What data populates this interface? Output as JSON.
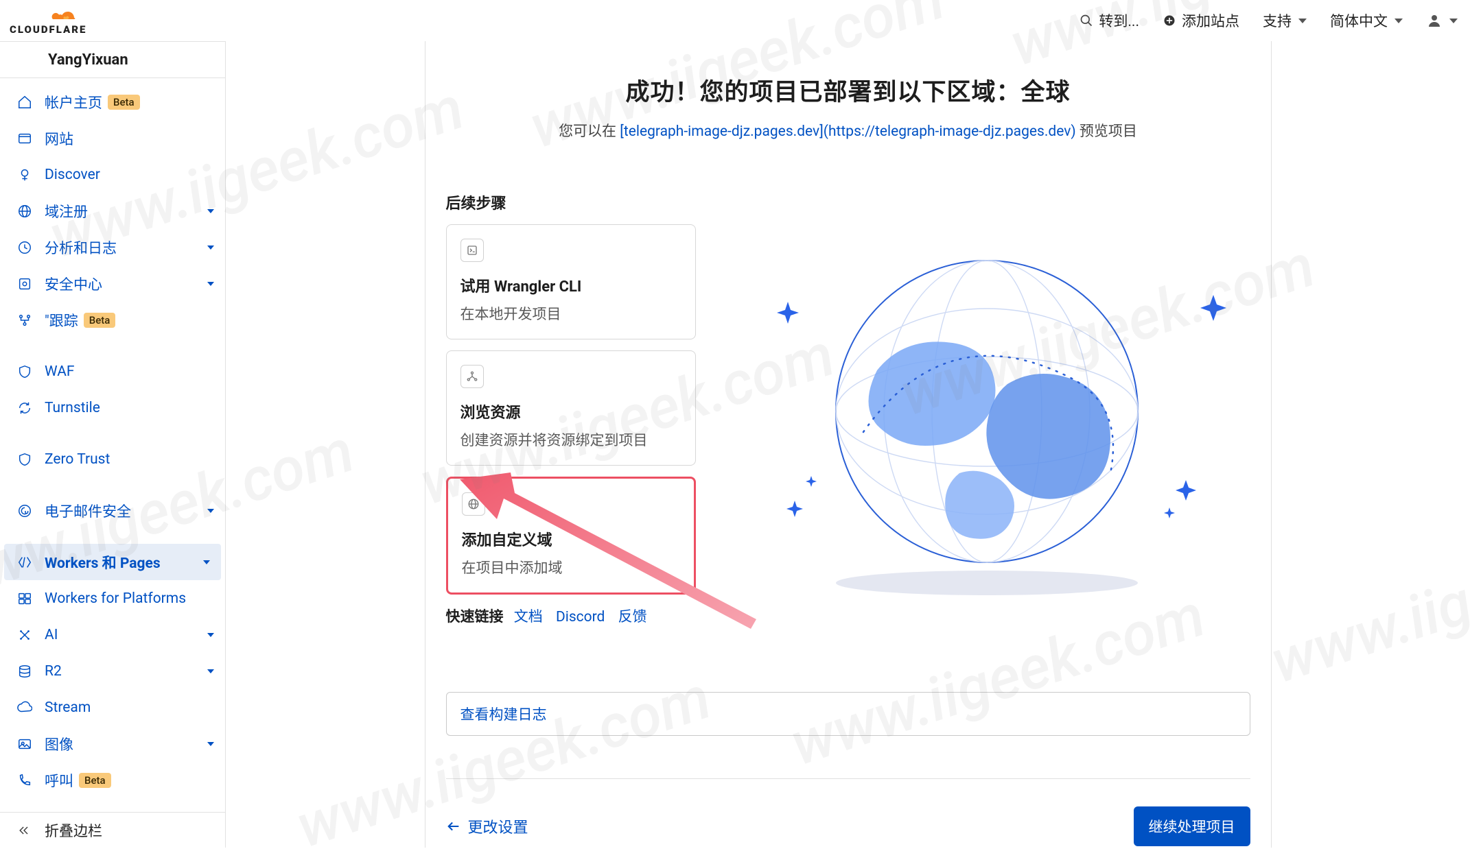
{
  "topbar": {
    "search_label": "转到...",
    "add_site": "添加站点",
    "support": "支持",
    "language": "简体中文"
  },
  "account": {
    "name": "YangYixuan"
  },
  "sidebar": {
    "items": [
      {
        "id": "home",
        "label": "帐户主页",
        "badge": "Beta",
        "caret": false
      },
      {
        "id": "websites",
        "label": "网站",
        "caret": false
      },
      {
        "id": "discover",
        "label": "Discover",
        "caret": false
      },
      {
        "id": "domain-reg",
        "label": "域注册",
        "caret": true
      },
      {
        "id": "analytics",
        "label": "分析和日志",
        "caret": true
      },
      {
        "id": "security-center",
        "label": "安全中心",
        "caret": true
      },
      {
        "id": "trace",
        "label": "\"跟踪",
        "badge": "Beta",
        "caret": false
      },
      {
        "id": "waf",
        "label": "WAF",
        "caret": false
      },
      {
        "id": "turnstile",
        "label": "Turnstile",
        "caret": false
      },
      {
        "id": "zero-trust",
        "label": "Zero Trust",
        "caret": false
      },
      {
        "id": "email-security",
        "label": "电子邮件安全",
        "caret": true
      },
      {
        "id": "workers-pages",
        "label": "Workers 和 Pages",
        "caret": true,
        "active": true
      },
      {
        "id": "workers-platforms",
        "label": "Workers for Platforms",
        "caret": false
      },
      {
        "id": "ai",
        "label": "AI",
        "caret": true
      },
      {
        "id": "r2",
        "label": "R2",
        "caret": true
      },
      {
        "id": "stream",
        "label": "Stream",
        "caret": false
      },
      {
        "id": "images",
        "label": "图像",
        "caret": true
      },
      {
        "id": "calls",
        "label": "呼叫",
        "badge": "Beta",
        "caret": false
      }
    ],
    "collapse_label": "折叠边栏"
  },
  "hero": {
    "title": "成功！您的项目已部署到以下区域：全球",
    "subtitle_prefix": "您可以在 ",
    "subtitle_link": "[telegraph-image-djz.pages.dev](https://telegraph-image-djz.pages.dev)",
    "subtitle_suffix": " 预览项目"
  },
  "next_steps": {
    "heading": "后续步骤",
    "cards": [
      {
        "id": "wrangler",
        "title": "试用 Wrangler CLI",
        "desc": "在本地开发项目"
      },
      {
        "id": "browse-resources",
        "title": "浏览资源",
        "desc": "创建资源并将资源绑定到项目"
      },
      {
        "id": "custom-domain",
        "title": "添加自定义域",
        "desc": "在项目中添加域"
      }
    ]
  },
  "quick_links": {
    "label": "快速链接",
    "links": [
      {
        "id": "docs",
        "label": "文档"
      },
      {
        "id": "discord",
        "label": "Discord"
      },
      {
        "id": "feedback",
        "label": "反馈"
      }
    ]
  },
  "log_box": {
    "label": "查看构建日志"
  },
  "footer": {
    "back": "更改设置",
    "continue": "继续处理项目"
  },
  "watermark": "www.iigeek.com"
}
